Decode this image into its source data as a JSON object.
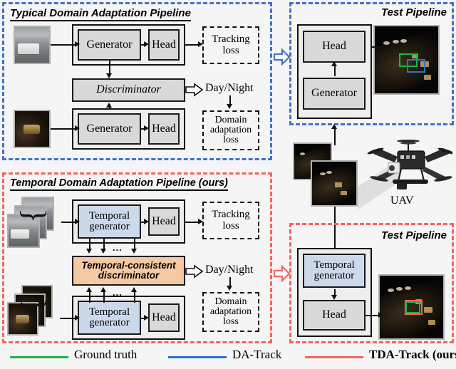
{
  "panels": {
    "typical": {
      "title": "Typical Domain Adaptation Pipeline",
      "blocks": {
        "generator_top": "Generator",
        "head_top": "Head",
        "discriminator": "Discriminator",
        "generator_bottom": "Generator",
        "head_bottom": "Head",
        "tracking_loss": "Tracking\nloss",
        "tracking_loss_l1": "Tracking",
        "tracking_loss_l2": "loss",
        "day_night": "Day/Night",
        "domain_loss_l1": "Domain",
        "domain_loss_l2": "adaptation",
        "domain_loss_l3": "loss"
      }
    },
    "temporal": {
      "title": "Temporal Domain Adaptation Pipeline  (ours)",
      "blocks": {
        "temporal_generator_top_l1": "Temporal",
        "temporal_generator_top_l2": "generator",
        "head_top": "Head",
        "discriminator_l1": "Temporal-consistent",
        "discriminator_l2": "discriminator",
        "temporal_generator_bottom_l1": "Temporal",
        "temporal_generator_bottom_l2": "generator",
        "head_bottom": "Head",
        "tracking_loss_l1": "Tracking",
        "tracking_loss_l2": "loss",
        "day_night": "Day/Night",
        "domain_loss_l1": "Domain",
        "domain_loss_l2": "adaptation",
        "domain_loss_l3": "loss",
        "ellipsis_top": "...",
        "ellipsis_bottom": "..."
      }
    },
    "test_top": {
      "title": "Test Pipeline",
      "blocks": {
        "head": "Head",
        "generator": "Generator"
      }
    },
    "test_bottom": {
      "title": "Test Pipeline",
      "blocks": {
        "temporal_generator_l1": "Temporal",
        "temporal_generator_l2": "generator",
        "head": "Head"
      }
    }
  },
  "uav": {
    "label": "UAV"
  },
  "legend": {
    "items": [
      {
        "label": "Ground truth",
        "color": "#23b24b",
        "bold": false
      },
      {
        "label": "DA-Track",
        "color": "#2f6fd0",
        "bold": false
      },
      {
        "label": "TDA-Track (ours)",
        "color": "#f4645f",
        "bold": true
      }
    ]
  },
  "colors": {
    "da_blue": "#4472c4",
    "tda_red": "#f4645f",
    "ground_truth_green": "#23b24b",
    "temporal_generator_fill": "#ccd9ea",
    "temporal_discriminator_fill": "#f5c9a3",
    "block_fill": "#d9d9d9",
    "outer_fill": "#eeeeee"
  }
}
